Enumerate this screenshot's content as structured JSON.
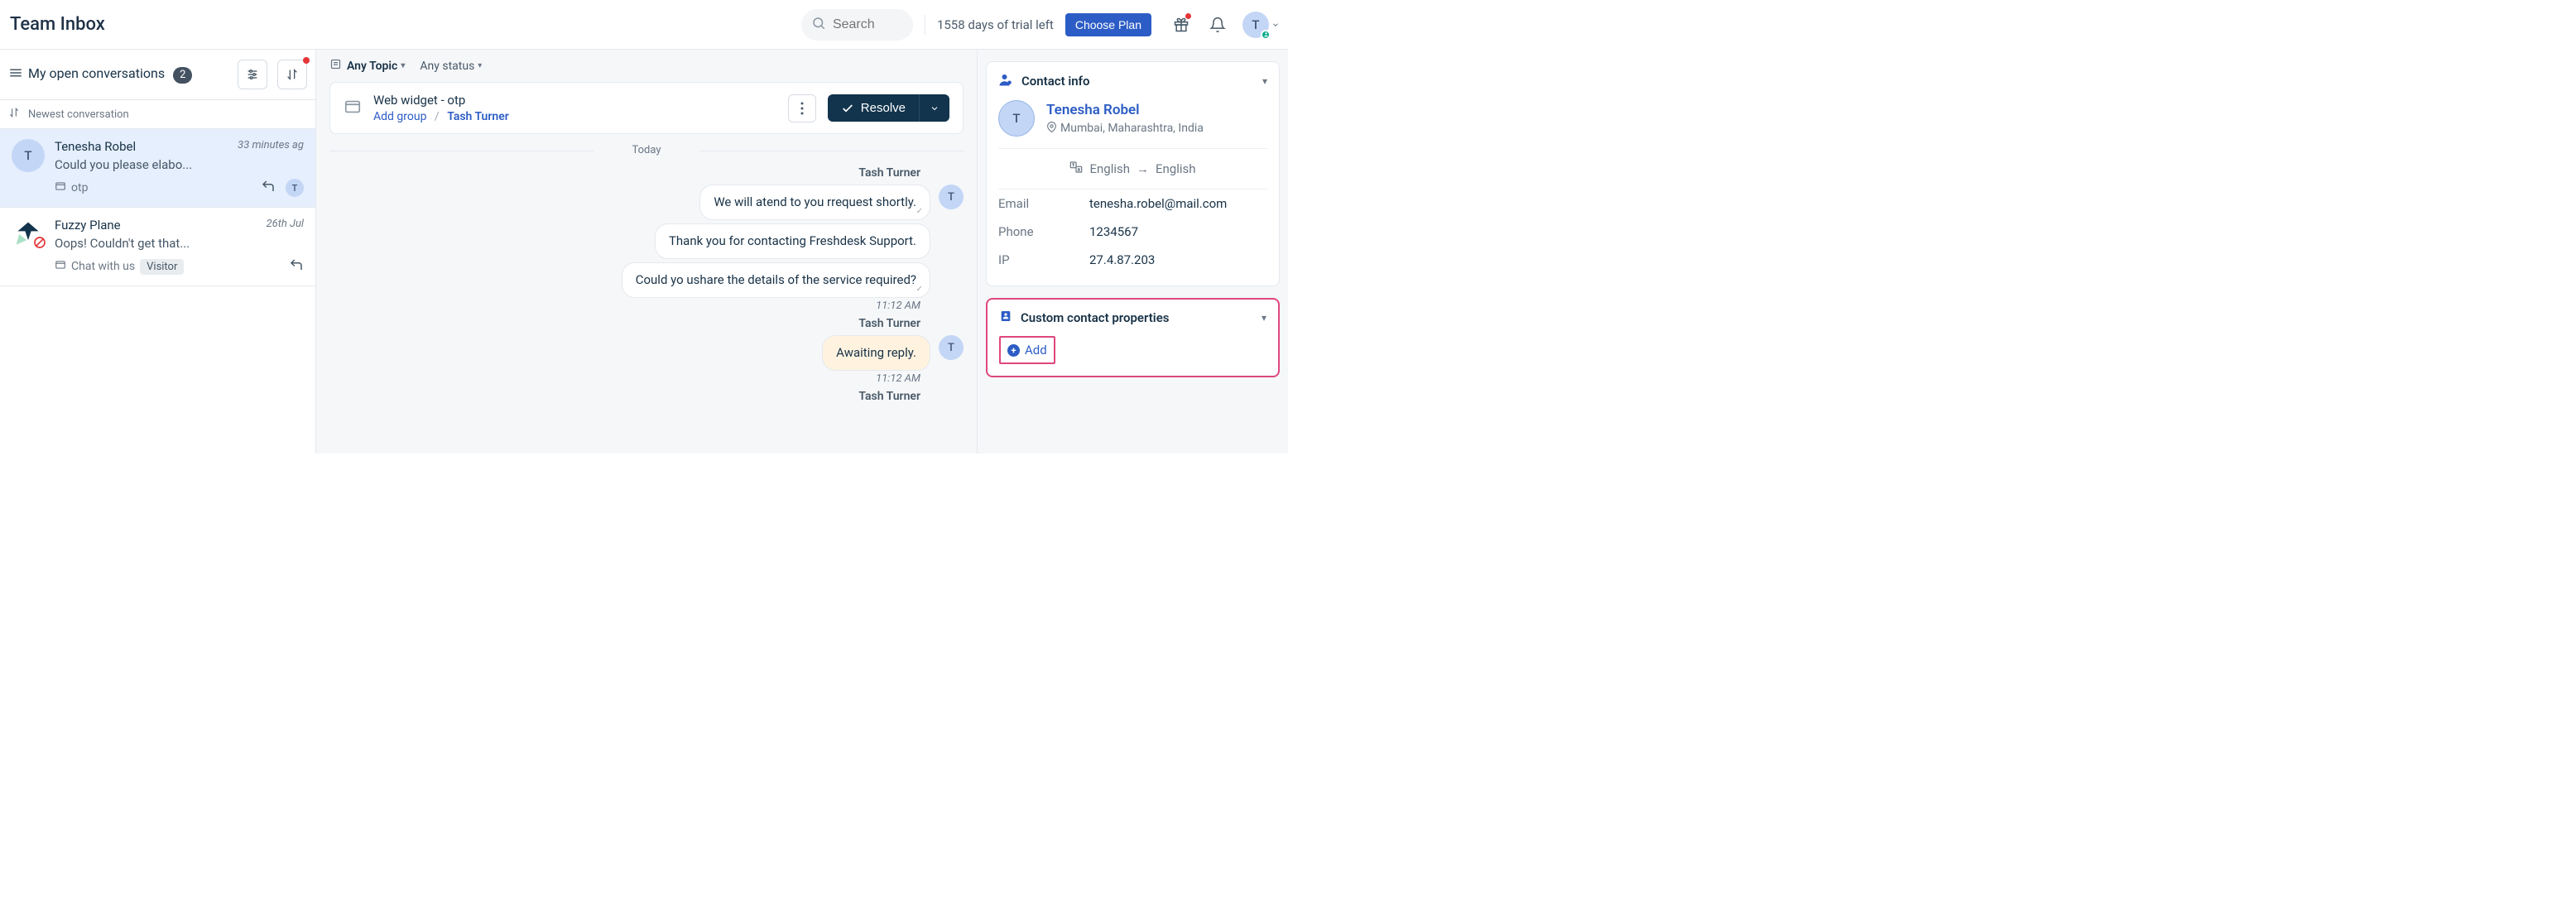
{
  "header": {
    "title": "Team Inbox",
    "search_placeholder": "Search",
    "trial_text": "1558 days of trial left",
    "choose_plan_label": "Choose Plan",
    "user_initial": "T"
  },
  "sidebar": {
    "title": "My open conversations",
    "count": "2",
    "sort_label": "Newest conversation",
    "conversations": [
      {
        "name": "Tenesha Robel",
        "time": "33 minutes ag",
        "preview": "Could you please elabo...",
        "channel": "otp",
        "assignee_initial": "T",
        "avatar_initial": "T"
      },
      {
        "name": "Fuzzy Plane",
        "time": "26th Jul",
        "preview": "Oops! Couldn't get that...",
        "channel": "Chat with us",
        "visitor_label": "Visitor"
      }
    ]
  },
  "center": {
    "filters": {
      "topic": "Any Topic",
      "status": "Any status"
    },
    "ticket": {
      "title": "Web widget - otp",
      "add_group": "Add group",
      "assignee": "Tash Turner",
      "resolve_label": "Resolve"
    },
    "today_label": "Today",
    "thread": [
      {
        "sender": "Tash Turner",
        "avatar": "T",
        "messages": [
          "We will atend to you rrequest shortly.",
          "Thank you for contacting Freshdesk Support.",
          "Could yo ushare the details of the service required?"
        ],
        "time": "11:12 AM"
      },
      {
        "sender": "Tash Turner",
        "avatar": "T",
        "messages": [
          "Awaiting reply."
        ],
        "time": "11:12 AM",
        "private": true
      },
      {
        "sender": "Tash Turner"
      }
    ]
  },
  "contact": {
    "panel_title": "Contact info",
    "name": "Tenesha Robel",
    "avatar_initial": "T",
    "location": "Mumbai, Maharashtra, India",
    "lang_from": "English",
    "lang_to": "English",
    "fields": {
      "email_label": "Email",
      "email": "tenesha.robel@mail.com",
      "phone_label": "Phone",
      "phone": "1234567",
      "ip_label": "IP",
      "ip": "27.4.87.203"
    }
  },
  "custom": {
    "panel_title": "Custom contact properties",
    "add_label": "Add"
  }
}
